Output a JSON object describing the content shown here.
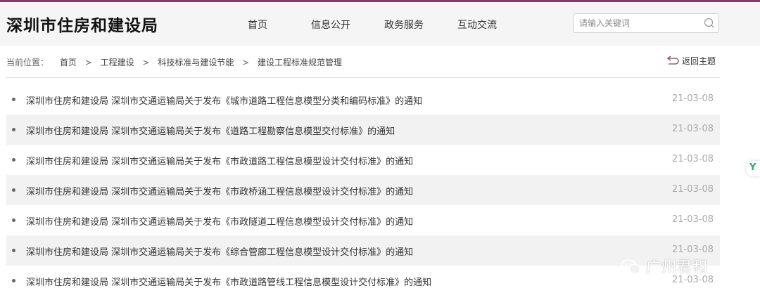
{
  "header": {
    "site_title": "深圳市住房和建设局",
    "nav": [
      "首页",
      "信息公开",
      "政务服务",
      "互动交流"
    ],
    "search_placeholder": "请输入关键词"
  },
  "breadcrumb": {
    "label": "当前位置：",
    "items": [
      "首页",
      "工程建设",
      "科技标准与建设节能",
      "建设工程标准规范管理"
    ],
    "separator": ">"
  },
  "back_topic": "返回主题",
  "articles": [
    {
      "title": "深圳市住房和建设局 深圳市交通运输局关于发布《城市道路工程信息模型分类和编码标准》的通知",
      "date": "21-03-08"
    },
    {
      "title": "深圳市住房和建设局 深圳市交通运输局关于发布《道路工程勘察信息模型交付标准》的通知",
      "date": "21-03-08"
    },
    {
      "title": "深圳市住房和建设局 深圳市交通运输局关于发布《市政道路工程信息模型设计交付标准》的通知",
      "date": "21-03-08"
    },
    {
      "title": "深圳市住房和建设局 深圳市交通运输局关于发布《市政桥涵工程信息模型设计交付标准》的通知",
      "date": "21-03-08"
    },
    {
      "title": "深圳市住房和建设局 深圳市交通运输局关于发布《市政隧道工程信息模型设计交付标准》的通知",
      "date": "21-03-08"
    },
    {
      "title": "深圳市住房和建设局 深圳市交通运输局关于发布《综合管廊工程信息模型设计交付标准》的通知",
      "date": "21-03-08"
    },
    {
      "title": "深圳市住房和建设局 深圳市交通运输局关于发布《市政道路管线工程信息模型设计交付标准》的通知",
      "date": "21-03-08"
    }
  ],
  "watermark": "广州君和",
  "colors": {
    "accent": "#8a3a6a",
    "date": "#aaaaaa",
    "alt_row": "#f2f2f2",
    "badge": "#27b06a"
  },
  "icons": {
    "search": "search-icon",
    "back": "return-arrow-icon",
    "badge": "side-badge-icon",
    "wechat": "wechat-icon"
  }
}
